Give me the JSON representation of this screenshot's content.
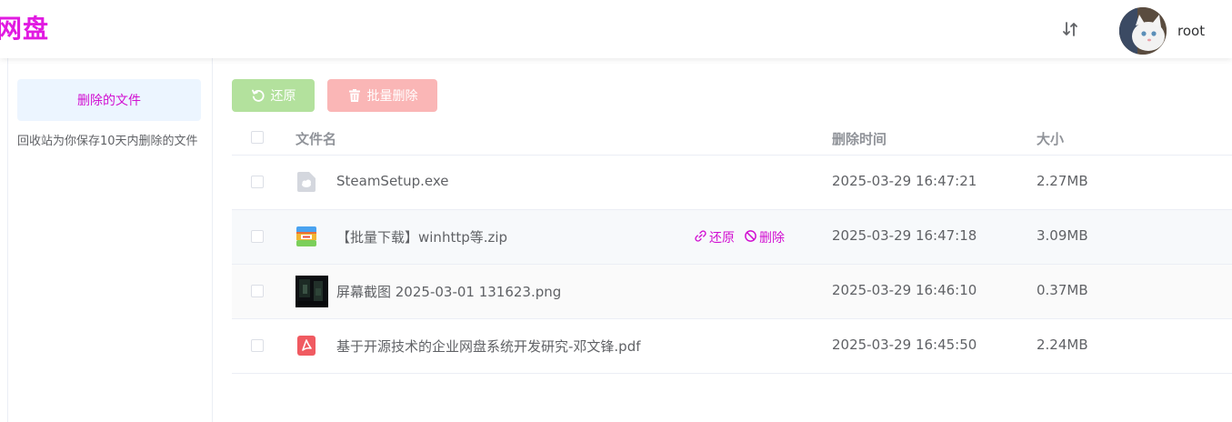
{
  "header": {
    "logo": "网盘",
    "username": "root",
    "sort_icon": "sort-arrows-icon"
  },
  "sidebar": {
    "active_item": "删除的文件",
    "hint": "回收站为你保存10天内删除的文件"
  },
  "toolbar": {
    "restore_label": "还原",
    "batch_delete_label": "批量删除",
    "restore_color": "#b3e19d",
    "delete_color": "#fab6b6"
  },
  "table": {
    "columns": {
      "name": "文件名",
      "deleted_time": "删除时间",
      "size": "大小"
    },
    "row_actions": {
      "restore": "还原",
      "delete": "删除"
    },
    "rows": [
      {
        "icon": "exe-file-icon",
        "name": "SteamSetup.exe",
        "deleted_time": "2025-03-29 16:47:21",
        "size": "2.27MB"
      },
      {
        "icon": "zip-archive-icon",
        "name": "【批量下载】winhttp等.zip",
        "deleted_time": "2025-03-29 16:47:18",
        "size": "3.09MB"
      },
      {
        "icon": "image-thumbnail",
        "name": "屏幕截图 2025-03-01 131623.png",
        "deleted_time": "2025-03-29 16:46:10",
        "size": "0.37MB"
      },
      {
        "icon": "pdf-file-icon",
        "name": "基于开源技术的企业网盘系统开发研究-邓文锋.pdf",
        "deleted_time": "2025-03-29 16:45:50",
        "size": "2.24MB"
      }
    ]
  },
  "colors": {
    "accent": "#d10fd1",
    "logo": "#e11be1"
  }
}
